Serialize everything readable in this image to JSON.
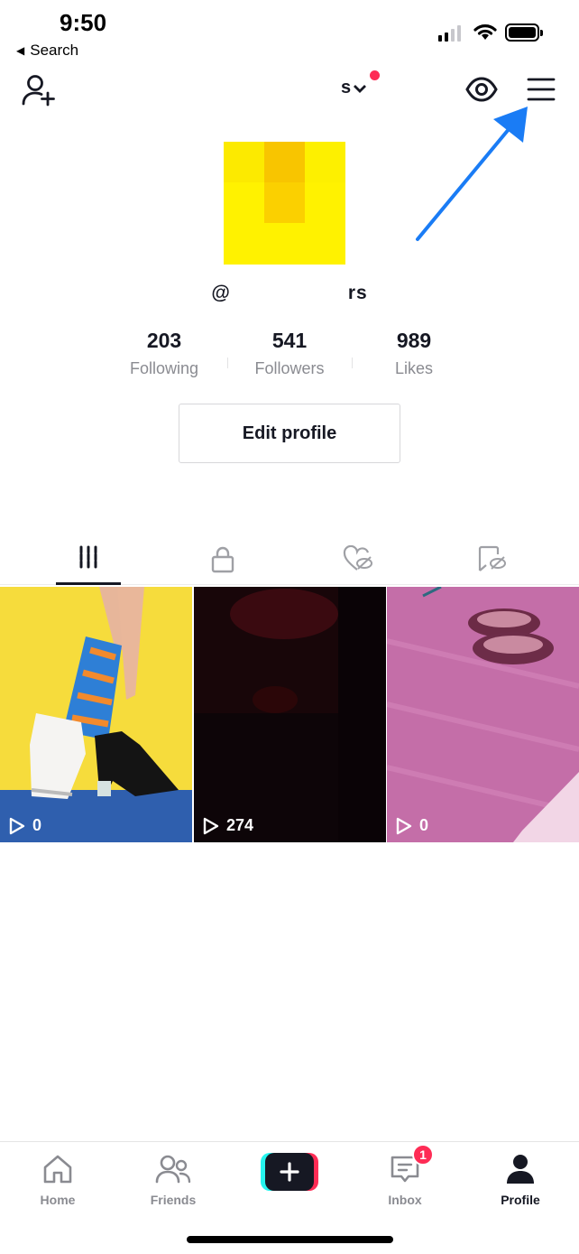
{
  "status_bar": {
    "time": "9:50",
    "back_label": "Search"
  },
  "header": {
    "username_visible": "s",
    "has_notification_dot": true,
    "icons": [
      "add-user-icon",
      "chevron-down-icon",
      "eye-icon",
      "menu-icon"
    ]
  },
  "profile": {
    "handle_prefix": "@",
    "handle_suffix": "rs",
    "stats": [
      {
        "value": "203",
        "label": "Following"
      },
      {
        "value": "541",
        "label": "Followers"
      },
      {
        "value": "989",
        "label": "Likes"
      }
    ],
    "edit_button_label": "Edit profile"
  },
  "tabs": [
    {
      "name": "videos-tab",
      "icon": "grid-icon",
      "active": true
    },
    {
      "name": "private-tab",
      "icon": "lock-icon",
      "active": false
    },
    {
      "name": "liked-tab",
      "icon": "hidden-heart-icon",
      "active": false
    },
    {
      "name": "favorites-tab",
      "icon": "hidden-bookmark-icon",
      "active": false
    }
  ],
  "videos": [
    {
      "views": "0"
    },
    {
      "views": "274"
    },
    {
      "views": "0"
    }
  ],
  "bottom_nav": {
    "items": [
      {
        "label": "Home"
      },
      {
        "label": "Friends"
      },
      {
        "label": ""
      },
      {
        "label": "Inbox",
        "badge": "1"
      },
      {
        "label": "Profile"
      }
    ]
  },
  "colors": {
    "accent": "#fe2c55",
    "cyan": "#25f4ee",
    "annotation_arrow": "#1a7cf5",
    "text_primary": "#161823",
    "text_secondary": "#8a8b91"
  }
}
